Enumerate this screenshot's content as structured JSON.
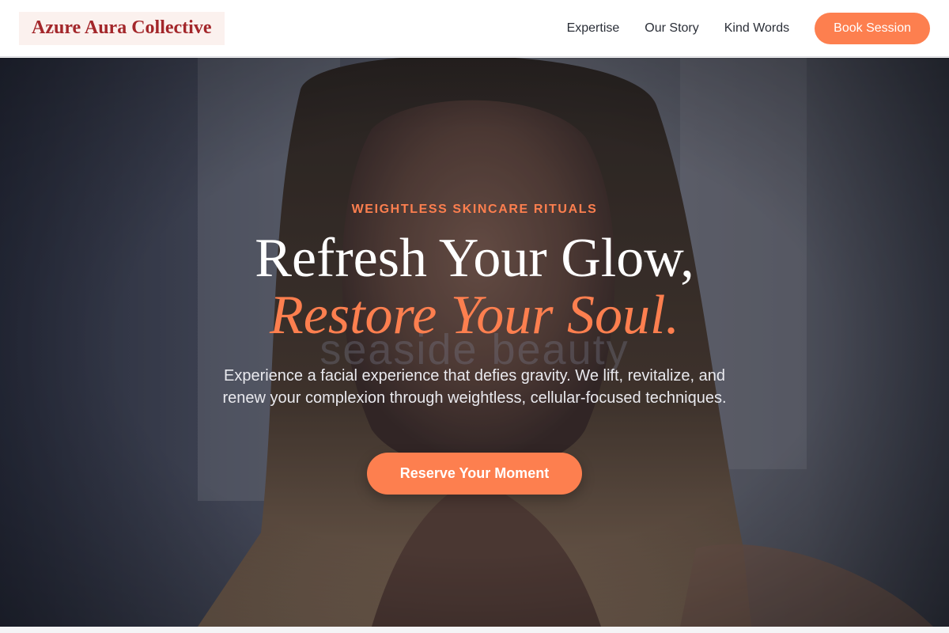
{
  "header": {
    "brand": "Azure Aura Collective",
    "nav": [
      "Expertise",
      "Our Story",
      "Kind Words"
    ],
    "cta_label": "Book Session"
  },
  "hero": {
    "eyebrow": "WEIGHTLESS SKINCARE RITUALS",
    "headline": "Refresh Your Glow,",
    "headline_accent": "Restore Your Soul.",
    "background_text": "seaside beauty",
    "description": "Experience a facial experience that defies gravity. We lift, revitalize, and renew your complexion through weightless, cellular-focused techniques.",
    "cta_label": "Reserve Your Moment"
  },
  "colors": {
    "accent": "#fd7f4f",
    "brand": "#a3262a",
    "brand_background": "#fbf1ee",
    "nav_text": "#2b2f38"
  }
}
